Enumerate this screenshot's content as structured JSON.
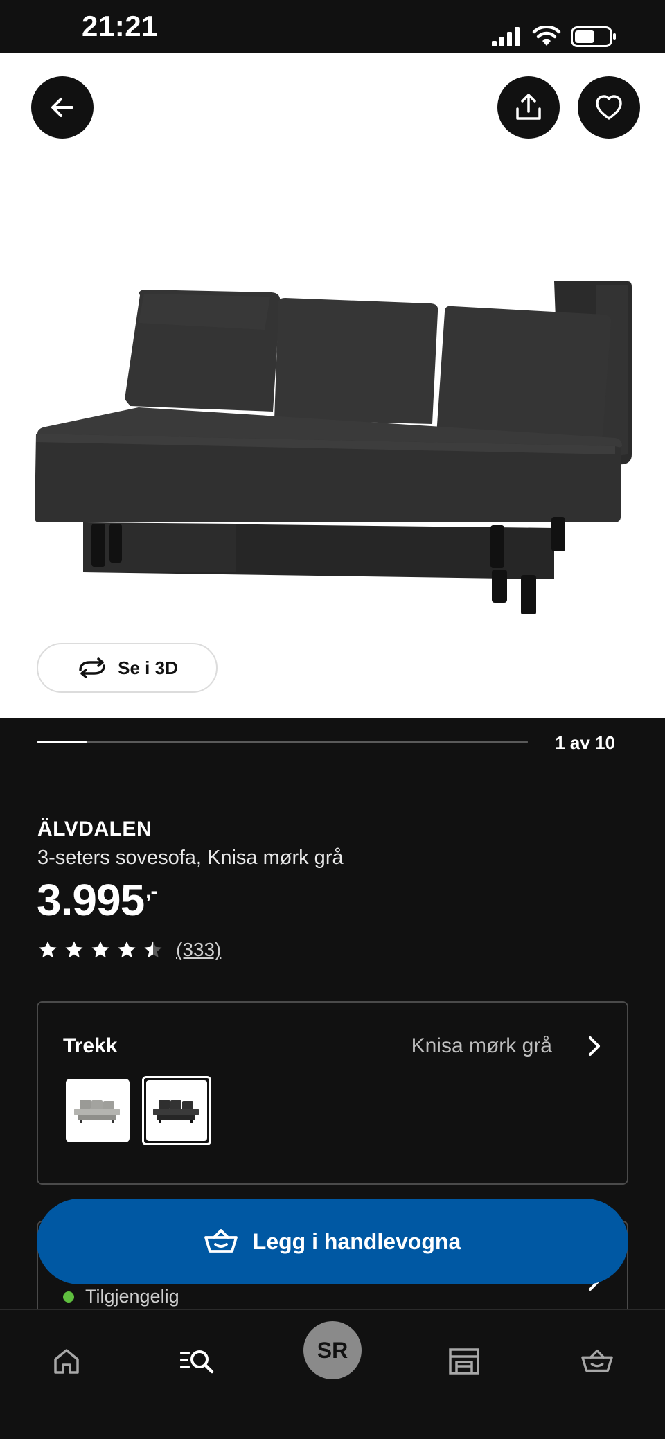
{
  "status_bar": {
    "time": "21:21"
  },
  "hero": {
    "view_3d_label": "Se i 3D"
  },
  "pager": {
    "label": "1 av 10",
    "progress": 0.1
  },
  "product": {
    "brand": "ÄLVDALEN",
    "description": "3-seters sovesofa, Knisa mørk grå",
    "price": "3.995",
    "price_suffix": ",-",
    "rating": 4.5,
    "review_count": "(333)"
  },
  "cover": {
    "title": "Trekk",
    "selected_value": "Knisa mørk grå",
    "swatches": [
      "light-grey-sofa",
      "dark-grey-sofa"
    ]
  },
  "cart_button": {
    "label": "Legg i handlevogna"
  },
  "availability": {
    "status": "Tilgjengelig"
  },
  "bottom_nav": {
    "profile_initials": "SR",
    "items": [
      "home-icon",
      "search-icon",
      "profile-avatar",
      "store-icon",
      "cart-icon"
    ]
  },
  "colors": {
    "accent_blue": "#0058a3",
    "background": "#111111",
    "available_green": "#5fbf3f"
  }
}
